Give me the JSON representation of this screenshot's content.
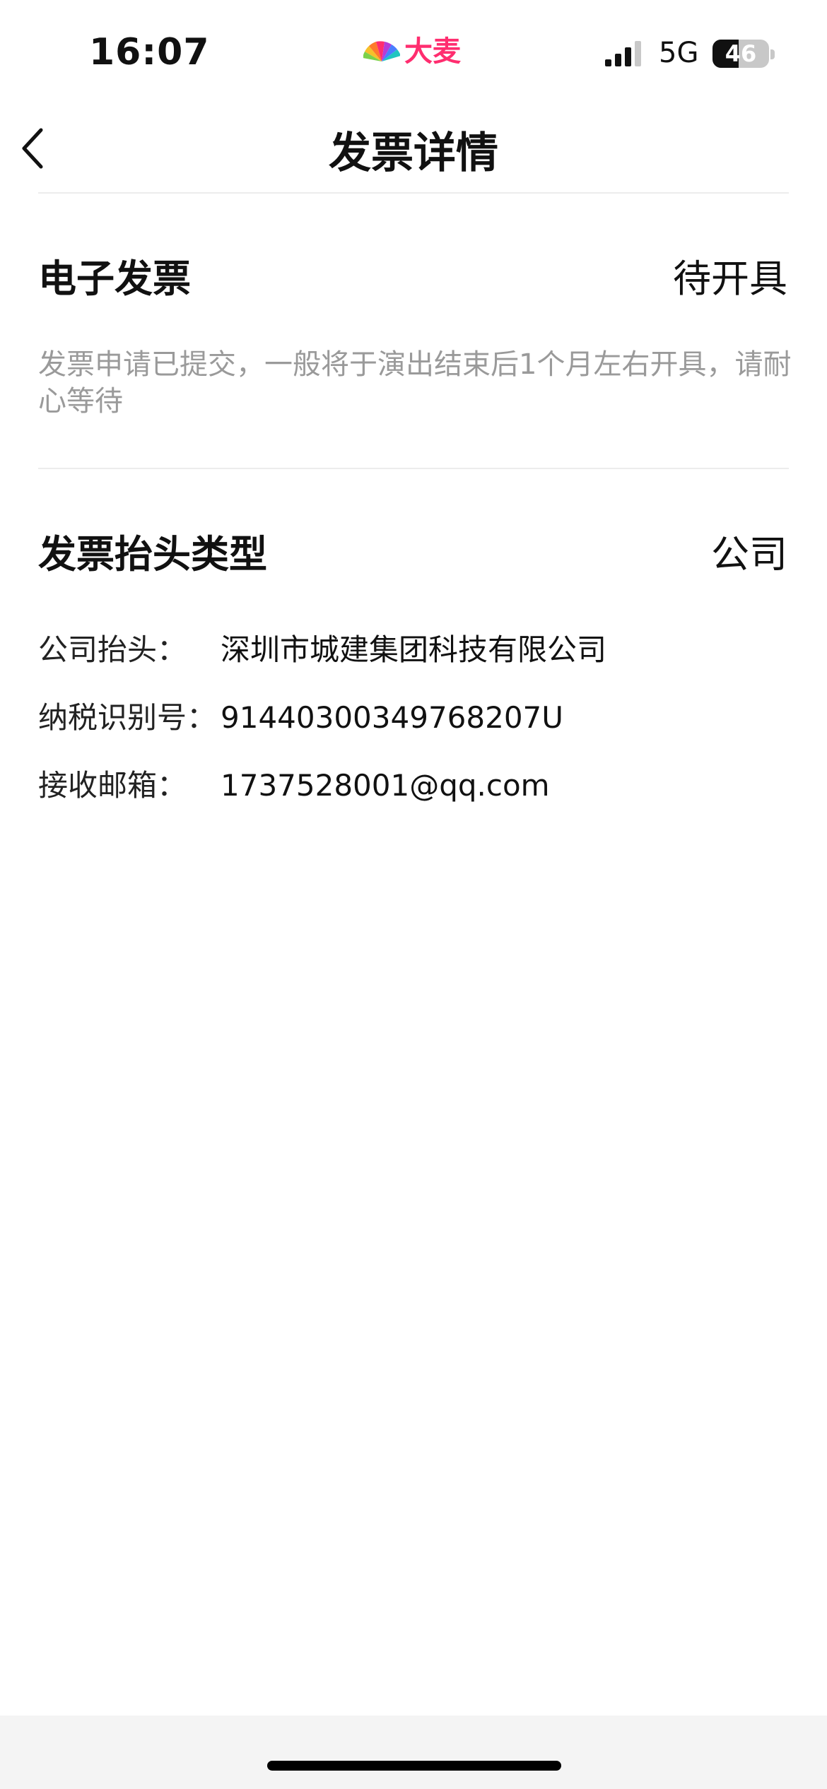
{
  "status_bar": {
    "time": "16:07",
    "brand_name": "大麦",
    "network": "5G",
    "battery_level": "46",
    "battery_percent": 46
  },
  "nav": {
    "title": "发票详情",
    "back_icon": "chevron-left-icon"
  },
  "invoice_status": {
    "title": "电子发票",
    "status": "待开具",
    "note": "发票申请已提交，一般将于演出结束后1个月左右开具，请耐心等待"
  },
  "invoice_header": {
    "title": "发票抬头类型",
    "type": "公司",
    "rows": [
      {
        "label": "公司抬头：",
        "value": "深圳市城建集团科技有限公司"
      },
      {
        "label": "纳税识别号：",
        "value": "91440300349768207U"
      },
      {
        "label": "接收邮箱：",
        "value": "1737528001@qq.com"
      }
    ]
  },
  "colors": {
    "brand": "#ff2d6f",
    "note_text": "#9a9a9a",
    "divider": "#ececec"
  }
}
